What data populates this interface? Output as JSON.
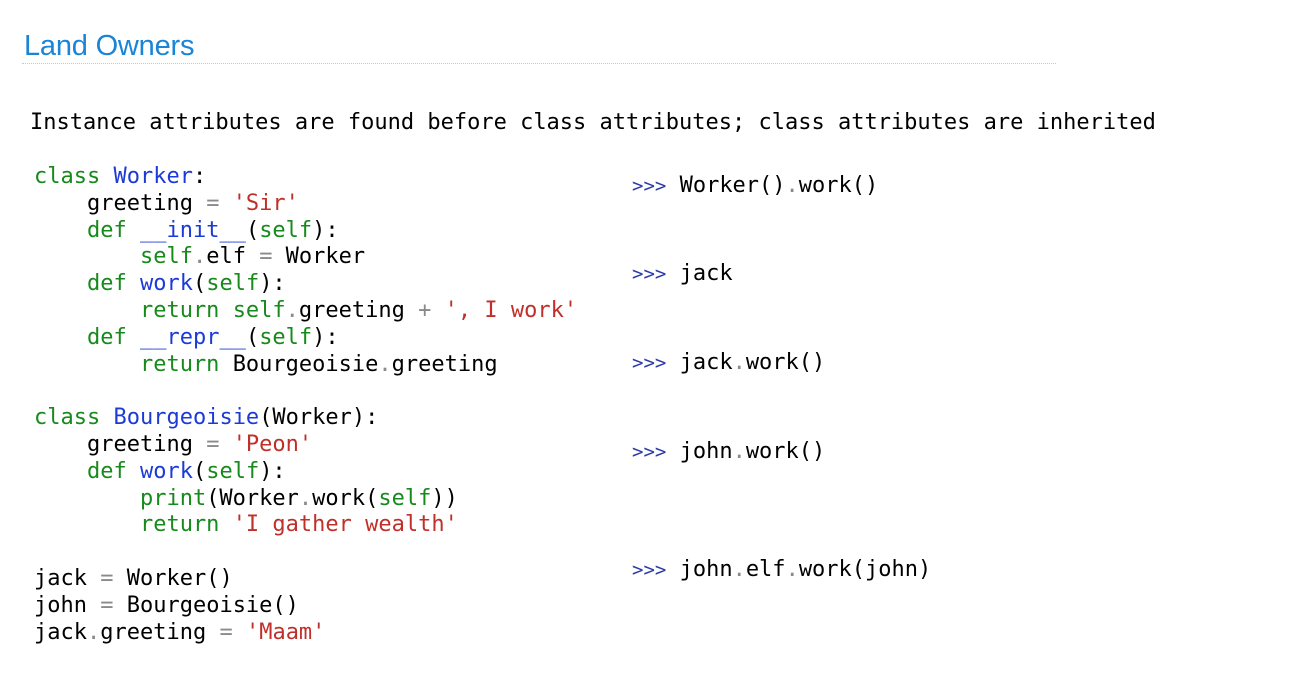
{
  "title": "Land Owners",
  "subtitle": "Instance attributes are found before class attributes; class attributes are inherited",
  "code": [
    [
      {
        "t": "class ",
        "c": "kw"
      },
      {
        "t": "Worker",
        "c": "nm"
      },
      {
        "t": ":",
        "c": "df"
      }
    ],
    [
      {
        "t": "    greeting ",
        "c": "df"
      },
      {
        "t": "=",
        "c": "op"
      },
      {
        "t": " ",
        "c": "df"
      },
      {
        "t": "'Sir'",
        "c": "st"
      }
    ],
    [
      {
        "t": "    def ",
        "c": "kw"
      },
      {
        "t": "__init__",
        "c": "nm"
      },
      {
        "t": "(",
        "c": "df"
      },
      {
        "t": "self",
        "c": "kw"
      },
      {
        "t": "):",
        "c": "df"
      }
    ],
    [
      {
        "t": "        self",
        "c": "kw"
      },
      {
        "t": ".",
        "c": "op"
      },
      {
        "t": "elf ",
        "c": "df"
      },
      {
        "t": "=",
        "c": "op"
      },
      {
        "t": " Worker",
        "c": "df"
      }
    ],
    [
      {
        "t": "    def ",
        "c": "kw"
      },
      {
        "t": "work",
        "c": "nm"
      },
      {
        "t": "(",
        "c": "df"
      },
      {
        "t": "self",
        "c": "kw"
      },
      {
        "t": "):",
        "c": "df"
      }
    ],
    [
      {
        "t": "        return ",
        "c": "kw"
      },
      {
        "t": "self",
        "c": "kw"
      },
      {
        "t": ".",
        "c": "op"
      },
      {
        "t": "greeting ",
        "c": "df"
      },
      {
        "t": "+",
        "c": "op"
      },
      {
        "t": " ",
        "c": "df"
      },
      {
        "t": "', I work'",
        "c": "st"
      }
    ],
    [
      {
        "t": "    def ",
        "c": "kw"
      },
      {
        "t": "__repr__",
        "c": "nm"
      },
      {
        "t": "(",
        "c": "df"
      },
      {
        "t": "self",
        "c": "kw"
      },
      {
        "t": "):",
        "c": "df"
      }
    ],
    [
      {
        "t": "        return ",
        "c": "kw"
      },
      {
        "t": "Bourgeoisie",
        "c": "df"
      },
      {
        "t": ".",
        "c": "op"
      },
      {
        "t": "greeting",
        "c": "df"
      }
    ],
    [],
    [
      {
        "t": "class ",
        "c": "kw"
      },
      {
        "t": "Bourgeoisie",
        "c": "nm"
      },
      {
        "t": "(Worker):",
        "c": "df"
      }
    ],
    [
      {
        "t": "    greeting ",
        "c": "df"
      },
      {
        "t": "=",
        "c": "op"
      },
      {
        "t": " ",
        "c": "df"
      },
      {
        "t": "'Peon'",
        "c": "st"
      }
    ],
    [
      {
        "t": "    def ",
        "c": "kw"
      },
      {
        "t": "work",
        "c": "nm"
      },
      {
        "t": "(",
        "c": "df"
      },
      {
        "t": "self",
        "c": "kw"
      },
      {
        "t": "):",
        "c": "df"
      }
    ],
    [
      {
        "t": "        print",
        "c": "kw"
      },
      {
        "t": "(Worker",
        "c": "df"
      },
      {
        "t": ".",
        "c": "op"
      },
      {
        "t": "work(",
        "c": "df"
      },
      {
        "t": "self",
        "c": "kw"
      },
      {
        "t": "))",
        "c": "df"
      }
    ],
    [
      {
        "t": "        return ",
        "c": "kw"
      },
      {
        "t": "'I gather wealth'",
        "c": "st"
      }
    ],
    [],
    [
      {
        "t": "jack ",
        "c": "df"
      },
      {
        "t": "=",
        "c": "op"
      },
      {
        "t": " Worker()",
        "c": "df"
      }
    ],
    [
      {
        "t": "john ",
        "c": "df"
      },
      {
        "t": "=",
        "c": "op"
      },
      {
        "t": " Bourgeoisie()",
        "c": "df"
      }
    ],
    [
      {
        "t": "jack",
        "c": "df"
      },
      {
        "t": ".",
        "c": "op"
      },
      {
        "t": "greeting ",
        "c": "df"
      },
      {
        "t": "=",
        "c": "op"
      },
      {
        "t": " ",
        "c": "df"
      },
      {
        "t": "'Maam'",
        "c": "st"
      }
    ]
  ],
  "prompts": [
    {
      "symbol": ">>>",
      "parts": [
        {
          "t": "Worker()",
          "c": "df"
        },
        {
          "t": ".",
          "c": "op"
        },
        {
          "t": "work()",
          "c": "df"
        }
      ]
    },
    {
      "symbol": ">>>",
      "parts": [
        {
          "t": "jack",
          "c": "df"
        }
      ]
    },
    {
      "symbol": ">>>",
      "parts": [
        {
          "t": "jack",
          "c": "df"
        },
        {
          "t": ".",
          "c": "op"
        },
        {
          "t": "work()",
          "c": "df"
        }
      ]
    },
    {
      "symbol": ">>>",
      "parts": [
        {
          "t": "john",
          "c": "df"
        },
        {
          "t": ".",
          "c": "op"
        },
        {
          "t": "work()",
          "c": "df"
        }
      ]
    },
    {
      "symbol": ">>>",
      "parts": [
        {
          "t": "john",
          "c": "df"
        },
        {
          "t": ".",
          "c": "op"
        },
        {
          "t": "elf",
          "c": "df"
        },
        {
          "t": ".",
          "c": "op"
        },
        {
          "t": "work(john)",
          "c": "df"
        }
      ]
    }
  ],
  "colors": {
    "title": "#1a84d6",
    "keyword": "#178a1c",
    "name": "#1c3bd6",
    "string": "#c0302a",
    "operator": "#8a8a8a",
    "prompt": "#2a3aa8"
  }
}
